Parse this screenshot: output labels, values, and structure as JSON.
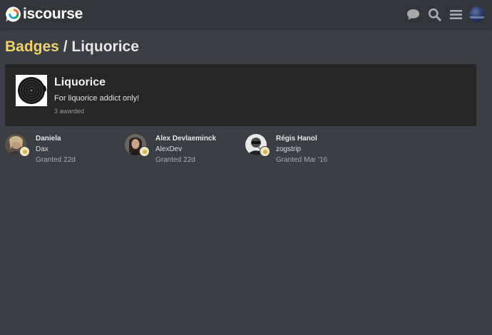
{
  "header": {
    "logo_text": "iscourse",
    "icons": [
      "chat-bubble-icon",
      "search-icon",
      "hamburger-menu-icon"
    ]
  },
  "breadcrumb": {
    "parent_label": "Badges",
    "separator": "/",
    "current_label": "Liquorice"
  },
  "badge": {
    "name": "Liquorice",
    "description": "For liquorice addict only!",
    "awarded_count": "3 awarded"
  },
  "grantees": [
    {
      "name": "Daniela",
      "username": "Dax",
      "granted_label": "Granted",
      "granted_when": "22d"
    },
    {
      "name": "Alex Devlaeminck",
      "username": "AlexDev",
      "granted_label": "Granted",
      "granted_when": "22d"
    },
    {
      "name": "Régis Hanol",
      "username": "zogstrip",
      "granted_label": "Granted",
      "granted_when": "Mar '16"
    }
  ],
  "colors": {
    "background": "#3b3e42",
    "header": "#323539",
    "card": "#262626",
    "accent": "#f0d36c"
  }
}
